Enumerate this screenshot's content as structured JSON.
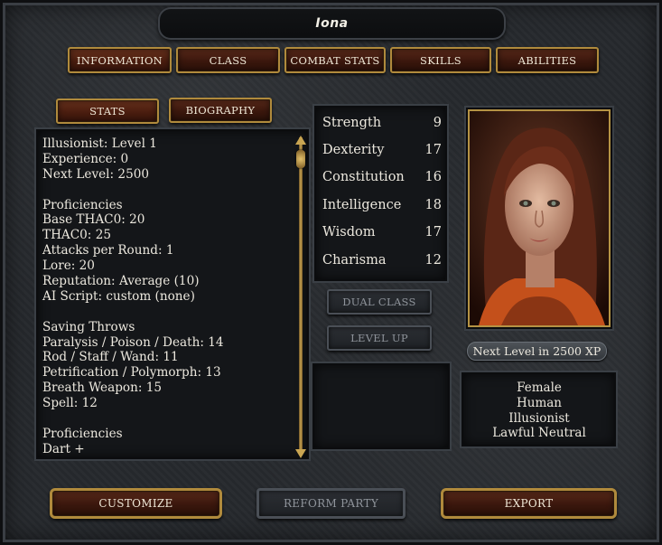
{
  "character": {
    "name": "Iona"
  },
  "tabs": [
    {
      "label": "INFORMATION"
    },
    {
      "label": "CLASS"
    },
    {
      "label": "COMBAT STATS"
    },
    {
      "label": "SKILLS"
    },
    {
      "label": "ABILITIES"
    }
  ],
  "subtabs": [
    {
      "label": "STATS"
    },
    {
      "label": "BIOGRAPHY"
    }
  ],
  "info_lines": [
    "Illusionist: Level 1",
    "Experience: 0",
    "Next Level: 2500",
    "",
    "Proficiencies",
    "Base THAC0: 20",
    "THAC0: 25",
    "Attacks per Round: 1",
    "Lore: 20",
    "Reputation: Average (10)",
    "AI Script: custom (none)",
    "",
    "Saving Throws",
    "Paralysis / Poison / Death: 14",
    "Rod / Staff / Wand: 11",
    "Petrification / Polymorph: 13",
    "Breath Weapon: 15",
    "Spell: 12",
    "",
    "Proficiencies",
    "Dart +"
  ],
  "stats": [
    {
      "name": "Strength",
      "value": "9"
    },
    {
      "name": "Dexterity",
      "value": "17"
    },
    {
      "name": "Constitution",
      "value": "16"
    },
    {
      "name": "Intelligence",
      "value": "18"
    },
    {
      "name": "Wisdom",
      "value": "17"
    },
    {
      "name": "Charisma",
      "value": "12"
    }
  ],
  "actions": {
    "dual_class": "DUAL CLASS",
    "level_up": "LEVEL UP"
  },
  "portrait": {
    "next_level": "Next Level in 2500 XP"
  },
  "description": {
    "gender": "Female",
    "race": "Human",
    "class": "Illusionist",
    "alignment": "Lawful Neutral"
  },
  "footer": {
    "customize": "CUSTOMIZE",
    "reform_party": "REFORM PARTY",
    "export": "EXPORT"
  },
  "colors": {
    "button_border": "#b08a3c",
    "button_fill": "#3a170d",
    "panel_bg": "#141619",
    "text": "#ece8de"
  }
}
